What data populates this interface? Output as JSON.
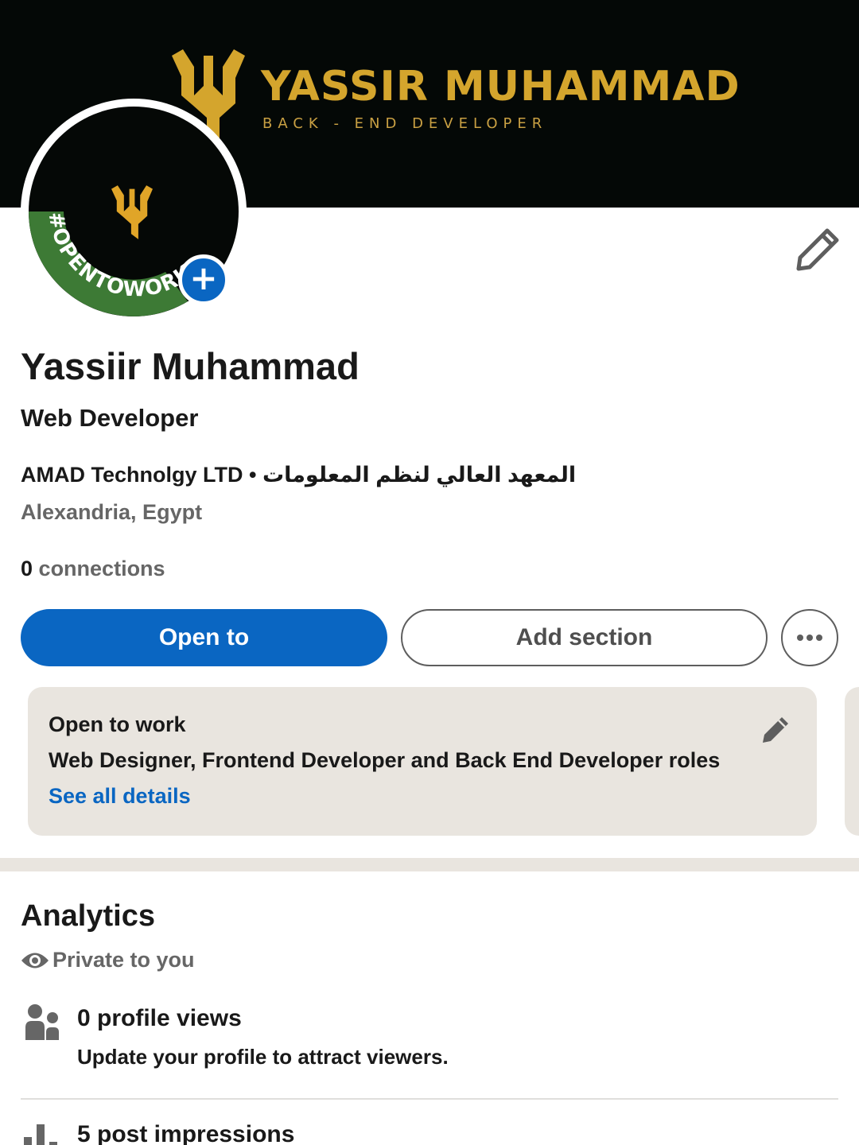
{
  "banner": {
    "name": "YASSIR MUHAMMAD",
    "tagline": "BACK - END DEVELOPER",
    "accent_color": "#d4a52d",
    "background_color": "#040806"
  },
  "avatar": {
    "badge_text": "#OPENTOWORK",
    "badge_color": "#3d7a35",
    "add_icon": "plus-icon"
  },
  "profile": {
    "name": "Yassiir Muhammad",
    "headline": "Web Developer",
    "organization": "AMAD Technolgy LTD • المعهد العالي لنظم المعلومات",
    "location": "Alexandria, Egypt",
    "connections_count": "0",
    "connections_label": "connections"
  },
  "actions": {
    "primary_label": "Open to",
    "secondary_label": "Add section",
    "more_icon": "more-horizontal-icon",
    "primary_color": "#0a66c2"
  },
  "open_to_work": {
    "title": "Open to work",
    "roles": "Web Designer, Frontend Developer and Back End Developer roles",
    "link_label": "See all details"
  },
  "analytics": {
    "title": "Analytics",
    "privacy_label": "Private to you",
    "items": [
      {
        "icon": "people-icon",
        "title": "0 profile views",
        "subtitle": "Update your profile to attract viewers."
      },
      {
        "icon": "bar-chart-icon",
        "title": "5 post impressions",
        "subtitle": ""
      }
    ]
  }
}
